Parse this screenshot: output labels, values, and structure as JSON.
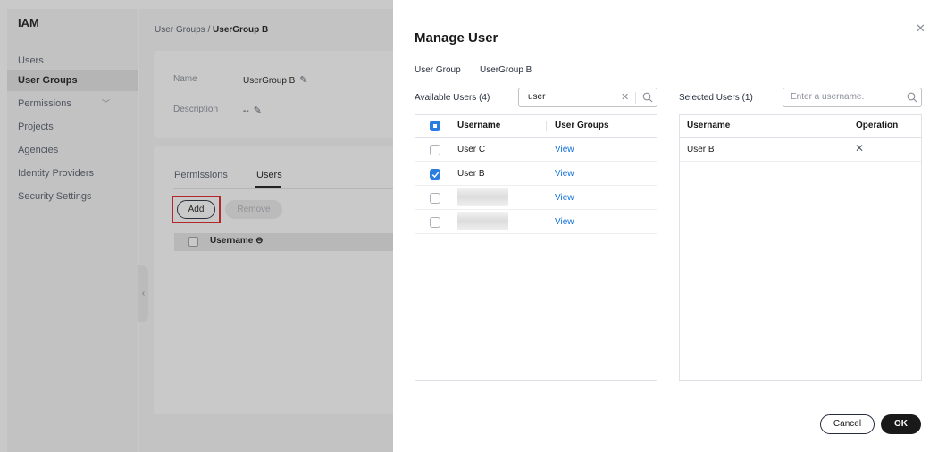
{
  "sidebar": {
    "title": "IAM",
    "items": [
      {
        "label": "Users"
      },
      {
        "label": "User Groups",
        "active": true
      },
      {
        "label": "Permissions",
        "has_chevron": true
      },
      {
        "label": "Projects"
      },
      {
        "label": "Agencies"
      },
      {
        "label": "Identity Providers"
      },
      {
        "label": "Security Settings"
      }
    ]
  },
  "breadcrumb": {
    "parent": "User Groups",
    "separator": "/",
    "current": "UserGroup B"
  },
  "details": {
    "name_label": "Name",
    "name_value": "UserGroup B",
    "description_label": "Description",
    "description_value": "--"
  },
  "group_tabs": [
    "Permissions",
    "Users"
  ],
  "group_actions": {
    "add": "Add",
    "remove": "Remove"
  },
  "group_table": {
    "header": "Username"
  },
  "dialog": {
    "title": "Manage User",
    "group_label": "User Group",
    "group_value": "UserGroup B",
    "available": {
      "label": "Available Users (4)",
      "search_value": "user",
      "columns": [
        "Username",
        "User Groups"
      ],
      "rows": [
        {
          "username": "User C",
          "groups": "View",
          "checked": false
        },
        {
          "username": "User B",
          "groups": "View",
          "checked": true
        },
        {
          "username": "",
          "groups": "View",
          "checked": false,
          "redacted": true
        },
        {
          "username": "",
          "groups": "View",
          "checked": false,
          "redacted": true
        }
      ]
    },
    "selected": {
      "label": "Selected Users (1)",
      "search_placeholder": "Enter a username.",
      "columns": [
        "Username",
        "Operation"
      ],
      "rows": [
        {
          "username": "User B"
        }
      ]
    },
    "cancel": "Cancel",
    "ok": "OK"
  },
  "colors": {
    "accent": "#2a7de1",
    "link": "#0e6fdb",
    "highlight": "#e02020",
    "dark": "#191919"
  }
}
